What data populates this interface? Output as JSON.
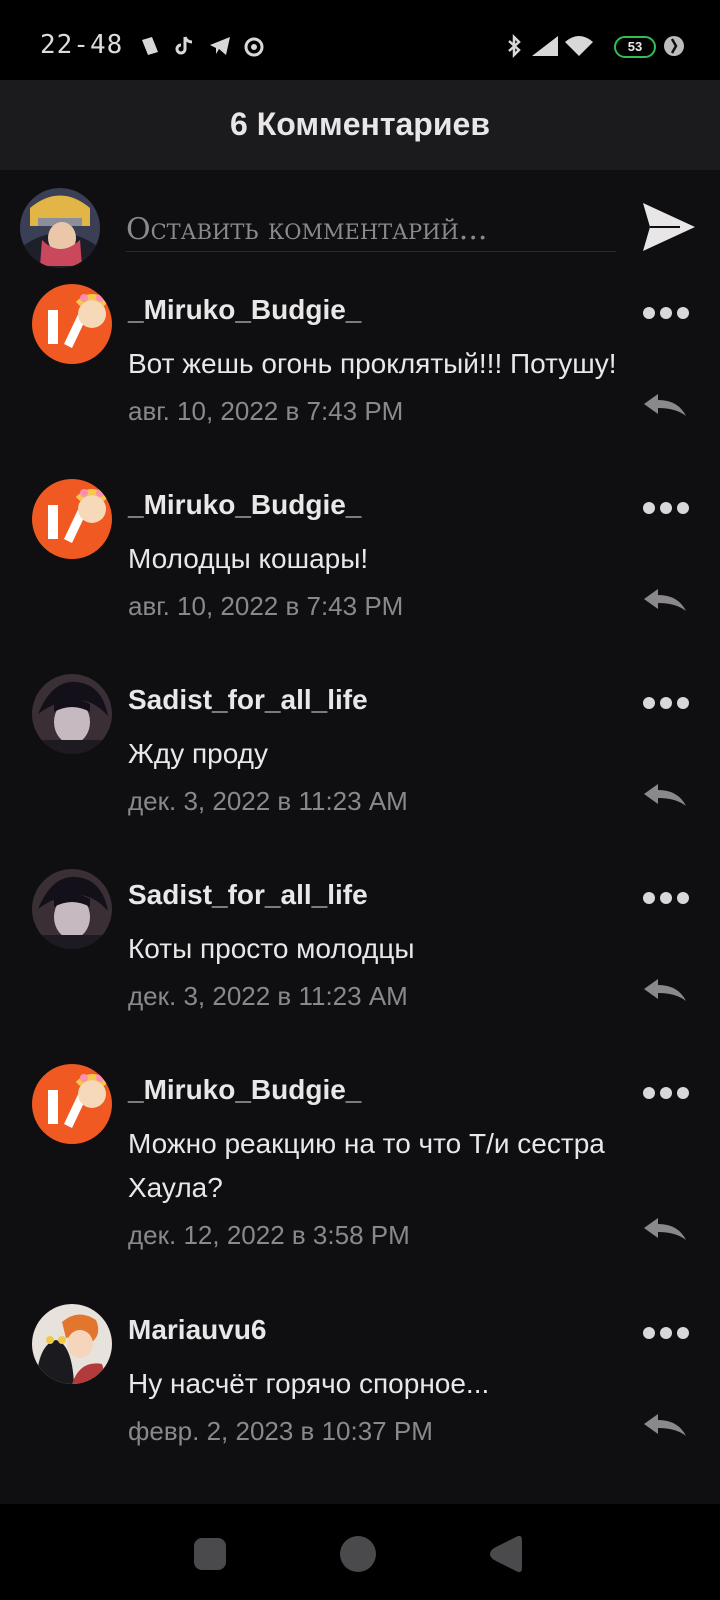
{
  "status_bar": {
    "time": "22-48",
    "battery": "53",
    "left_icons": [
      "notification-icon",
      "tiktok-icon",
      "telegram-icon",
      "camera-icon"
    ],
    "right_icons": [
      "bluetooth-icon",
      "signal-icon",
      "wifi-icon",
      "battery-icon",
      "sync-icon"
    ]
  },
  "header": {
    "title": "6 Комментариев"
  },
  "compose": {
    "placeholder": "Оставить комментарий..."
  },
  "comments": [
    {
      "author": "_Miruko_Budgie_",
      "text": "Вот жешь огонь проклятый!!! Потушу!",
      "date": "авг. 10, 2022 в 7:43 PM",
      "avatar": "miruko"
    },
    {
      "author": "_Miruko_Budgie_",
      "text": "Молодцы кошары!",
      "date": "авг. 10, 2022 в 7:43 PM",
      "avatar": "miruko"
    },
    {
      "author": "Sadist_for_all_life",
      "text": "Жду проду",
      "date": "дек. 3, 2022 в 11:23 AM",
      "avatar": "sadist"
    },
    {
      "author": "Sadist_for_all_life",
      "text": "Коты просто молодцы",
      "date": "дек. 3, 2022 в 11:23 AM",
      "avatar": "sadist"
    },
    {
      "author": "_Miruko_Budgie_",
      "text": "Можно реакцию на то что Т/и сестра Хаула?",
      "date": "дек. 12, 2022 в 3:58 PM",
      "avatar": "miruko"
    },
    {
      "author": "Mariauvu6",
      "text": "Ну насчёт горячо спорное...",
      "date": "февр. 2, 2023 в 10:37 PM",
      "avatar": "mariauvu"
    }
  ],
  "colors": {
    "background": "#0f0e10",
    "header": "#1b1a1c",
    "text": "#e9e7e8",
    "muted": "#8a888a",
    "battery_accent": "#2fbf55",
    "avatar_orange": "#f05a22"
  }
}
